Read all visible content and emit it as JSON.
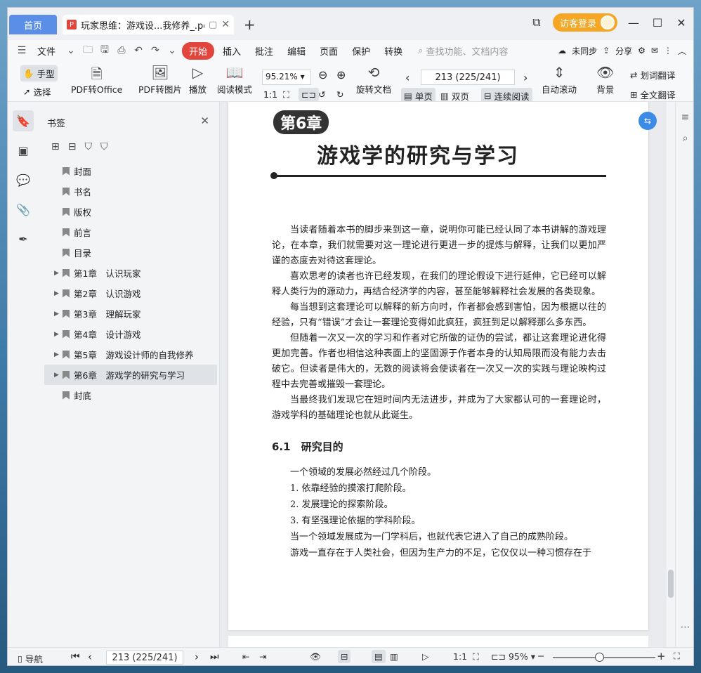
{
  "titlebar": {
    "home_tab": "首页",
    "doc_tab": "玩家思维：游戏设...我修养_.pdf",
    "login": "访客登录"
  },
  "menu": {
    "file": "文件",
    "start": "开始",
    "items": [
      "插入",
      "批注",
      "编辑",
      "页面",
      "保护",
      "转换"
    ],
    "search_placeholder": "查找功能、文档内容",
    "sync": "未同步",
    "share": "分享"
  },
  "toolbar": {
    "hand": "手型",
    "select": "选择",
    "pdf_office": "PDF转Office",
    "pdf_image": "PDF转图片",
    "play": "播放",
    "read_mode": "阅读模式",
    "zoom": "95.21%",
    "rotate": "旋转文档",
    "page_indicator": "213 (225/241)",
    "single": "单页",
    "double": "双页",
    "continuous": "连续阅读",
    "auto_scroll": "自动滚动",
    "background": "背景",
    "translate": "划词翻译",
    "full_translate": "全文翻译"
  },
  "bookmarks": {
    "title": "书签",
    "items": [
      {
        "label": "封面",
        "expandable": false
      },
      {
        "label": "书名",
        "expandable": false
      },
      {
        "label": "版权",
        "expandable": false
      },
      {
        "label": "前言",
        "expandable": false
      },
      {
        "label": "目录",
        "expandable": false
      },
      {
        "label": "第1章　认识玩家",
        "expandable": true
      },
      {
        "label": "第2章　认识游戏",
        "expandable": true
      },
      {
        "label": "第3章　理解玩家",
        "expandable": true
      },
      {
        "label": "第4章　设计游戏",
        "expandable": true
      },
      {
        "label": "第5章　游戏设计师的自我修养",
        "expandable": true
      },
      {
        "label": "第6章　游戏学的研究与学习",
        "expandable": true,
        "selected": true
      },
      {
        "label": "封底",
        "expandable": false
      }
    ]
  },
  "page": {
    "chapter_label": "第6章",
    "chapter_title": "游戏学的研究与学习",
    "paragraphs": [
      "当读者随着本书的脚步来到这一章，说明你可能已经认同了本书讲解的游戏理论，在本章，我们就需要对这一理论进行更进一步的提炼与解释，让我们以更加严谨的态度去对待这套理论。",
      "喜欢思考的读者也许已经发现，在我们的理论假设下进行延伸，它已经可以解释人类行为的源动力，再结合经济学的内容，甚至能够解释社会发展的各类现象。",
      "每当想到这套理论可以解释的新方向时，作者都会感到害怕，因为根据以往的经验，只有“错误”才会让一套理论变得如此疯狂，疯狂到足以解释那么多东西。",
      "但随着一次又一次的学习和作者对它所做的证伪的尝试，都让这套理论进化得更加完善。作者也相信这种表面上的坚固源于作者本身的认知局限而没有能力去击破它。但读者是伟大的，无数的阅读将会使读者在一次又一次的实践与理论映构过程中去完善或摧毁一套理论。",
      "当最终我们发现它在短时间内无法进步，并成为了大家都认可的一套理论时，游戏学科的基础理论也就从此诞生。"
    ],
    "section_title": "6.1　研究目的",
    "list": [
      "一个领域的发展必然经过几个阶段。",
      "1. 依靠经验的摸滚打爬阶段。",
      "2. 发展理论的探索阶段。",
      "3. 有坚强理论依据的学科阶段。",
      "当一个领域发展成为一门学科后，也就代表它进入了自己的成熟阶段。",
      "游戏一直存在于人类社会，但因为生产力的不足，它仅仅以一种习惯存在于"
    ]
  },
  "status": {
    "nav": "导航",
    "page_indicator": "213 (225/241)",
    "zoom": "95%",
    "zoom_level": 0.45
  }
}
